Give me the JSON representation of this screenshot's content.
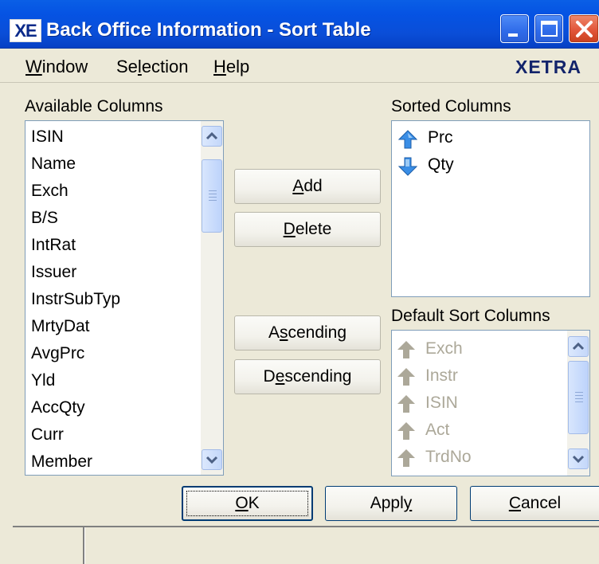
{
  "window": {
    "logo": "XE",
    "title": "Back Office Information - Sort Table",
    "controls": [
      "minimize-button",
      "maximize-button",
      "close-button"
    ]
  },
  "menu": {
    "items": [
      {
        "label": "Window",
        "underline": "W"
      },
      {
        "label": "Selection",
        "underline": "l"
      },
      {
        "label": "Help",
        "underline": "H"
      }
    ],
    "brand": "XETRA"
  },
  "available": {
    "label": "Available Columns",
    "items": [
      "ISIN",
      "Name",
      "Exch",
      "B/S",
      "IntRat",
      "Issuer",
      "InstrSubTyp",
      "MrtyDat",
      "AvgPrc",
      "Yld",
      "AccQty",
      "Curr",
      "Member"
    ]
  },
  "sorted": {
    "label": "Sorted Columns",
    "items": [
      {
        "label": "Prc",
        "direction": "ascending",
        "icon": "arrow-up-icon"
      },
      {
        "label": "Qty",
        "direction": "descending",
        "icon": "arrow-down-icon"
      }
    ]
  },
  "defaults": {
    "label": "Default Sort Columns",
    "items": [
      "Exch",
      "Instr",
      "ISIN",
      "Act",
      "TrdNo"
    ]
  },
  "buttons": {
    "add": {
      "pre": "",
      "u": "A",
      "post": "dd"
    },
    "delete": {
      "pre": "",
      "u": "D",
      "post": "elete"
    },
    "ascending": {
      "pre": "A",
      "u": "s",
      "post": "cending"
    },
    "descending": {
      "pre": "D",
      "u": "e",
      "post": "scending"
    },
    "ok": {
      "pre": "",
      "u": "O",
      "post": "K"
    },
    "apply": {
      "pre": "Appl",
      "u": "y",
      "post": ""
    },
    "cancel": {
      "pre": "",
      "u": "C",
      "post": "ancel"
    }
  },
  "colors": {
    "titlebar": "#0553e3",
    "sort_arrow": "#3a8ee6",
    "disabled_arrow": "#aca899"
  }
}
